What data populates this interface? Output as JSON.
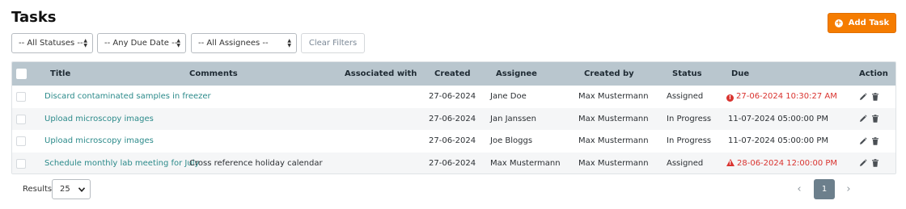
{
  "page": {
    "title": "Tasks"
  },
  "toolbar": {
    "add_label": "Add Task",
    "add_color": "#f57c00"
  },
  "filters": {
    "status": "-- All Statuses --",
    "due": "-- Any Due Date --",
    "assignee": "-- All Assignees --",
    "clear_label": "Clear Filters"
  },
  "table": {
    "columns": [
      "Title",
      "Comments",
      "Associated with",
      "Created",
      "Assignee",
      "Created by",
      "Status",
      "Due",
      "Action"
    ],
    "rows": [
      {
        "title": "Discard contaminated samples in freezer",
        "comments": "",
        "associated": "",
        "created": "27-06-2024",
        "assignee": "Jane Doe",
        "created_by": "Max Mustermann",
        "status": "Assigned",
        "due": "27-06-2024 10:30:27 AM",
        "due_state": "overdue",
        "due_icon": "exclamation-circle-icon"
      },
      {
        "title": "Upload microscopy images",
        "comments": "",
        "associated": "",
        "created": "27-06-2024",
        "assignee": "Jan Janssen",
        "created_by": "Max Mustermann",
        "status": "In Progress",
        "due": "11-07-2024 05:00:00 PM",
        "due_state": "normal",
        "due_icon": ""
      },
      {
        "title": "Upload microscopy images",
        "comments": "",
        "associated": "",
        "created": "27-06-2024",
        "assignee": "Joe Bloggs",
        "created_by": "Max Mustermann",
        "status": "In Progress",
        "due": "11-07-2024 05:00:00 PM",
        "due_state": "normal",
        "due_icon": ""
      },
      {
        "title": "Schedule monthly lab meeting for July",
        "comments": "Cross reference holiday calendar",
        "associated": "",
        "created": "27-06-2024",
        "assignee": "Max Mustermann",
        "created_by": "Max Mustermann",
        "status": "Assigned",
        "due": "28-06-2024 12:00:00 PM",
        "due_state": "warning",
        "due_icon": "warning-triangle-icon"
      }
    ]
  },
  "footer": {
    "results_label": "Results:",
    "page_size": "25",
    "current_page": "1"
  },
  "colors": {
    "header_bg": "#b9c6ce",
    "link": "#2b8a8a",
    "overdue": "#d9332f",
    "pager_active": "#6c7f8c"
  }
}
